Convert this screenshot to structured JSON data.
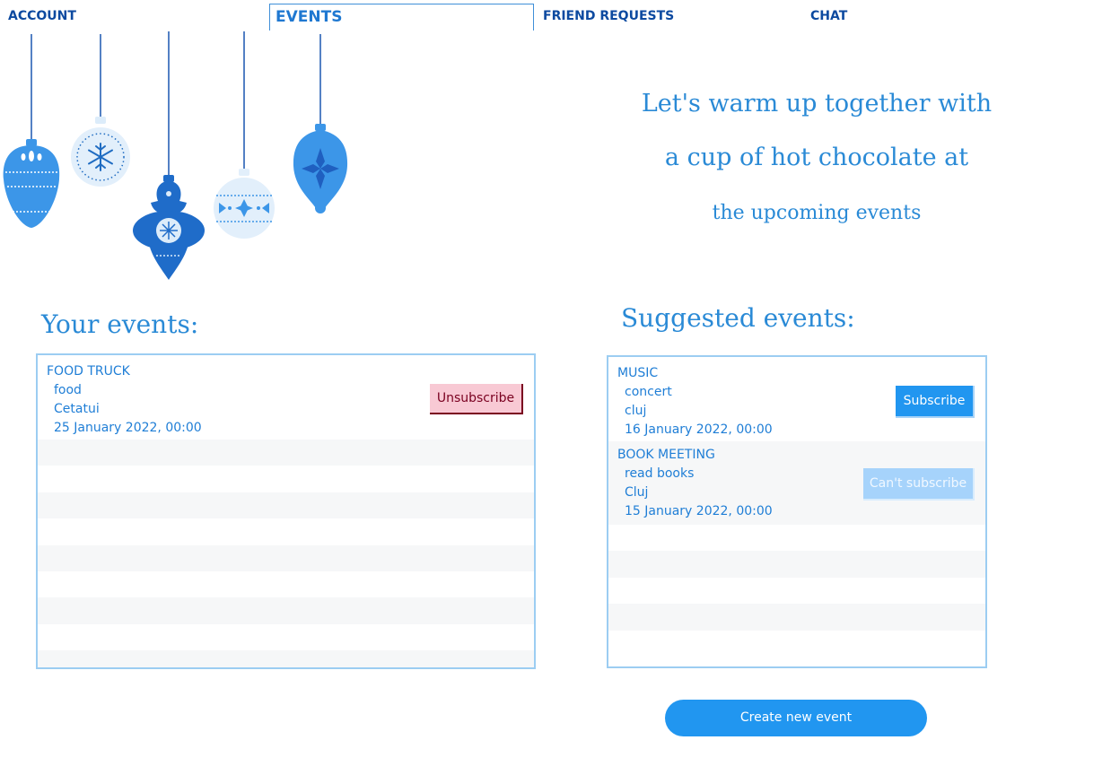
{
  "nav": {
    "tabs": [
      {
        "label": "ACCOUNT"
      },
      {
        "label": "EVENTS"
      },
      {
        "label": "FRIEND REQUESTS"
      },
      {
        "label": "CHAT"
      }
    ],
    "active_tab": "EVENTS"
  },
  "slogan": {
    "line1": "Let's warm up together with",
    "line2": "a cup of hot chocolate at",
    "line3": "the upcoming events"
  },
  "your_events": {
    "heading": "Your events:",
    "items": [
      {
        "name": "FOOD TRUCK",
        "category": "food",
        "location": "Cetatui",
        "date": "25 January 2022, 00:00",
        "action": "Unsubscribe"
      }
    ]
  },
  "suggested_events": {
    "heading": "Suggested events:",
    "items": [
      {
        "name": "MUSIC",
        "category": "concert",
        "location": "cluj",
        "date": "16 January 2022, 00:00",
        "action": "Subscribe"
      },
      {
        "name": "BOOK MEETING",
        "category": "read books",
        "location": "Cluj",
        "date": "15 January 2022, 00:00",
        "action": "Can't subscribe"
      }
    ]
  },
  "create_button": "Create new event",
  "colors": {
    "accent": "#2196f0",
    "nav_text": "#0d4aa0",
    "heading": "#2a8ad6",
    "unsubscribe_bg": "#f8c9d4",
    "disabled_bg": "#a6d3fb"
  },
  "icons": [
    "christmas-ornament-icon",
    "snowflake-icon"
  ]
}
